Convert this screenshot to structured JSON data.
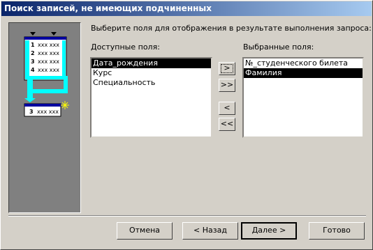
{
  "window": {
    "title": "Поиск записей, не имеющих подчиненных"
  },
  "instruction": "Выберите поля для отображения в результате выполнения запроса:",
  "available": {
    "label": "Доступные поля:",
    "items": [
      {
        "text": "Дата_рождения",
        "selected": true
      },
      {
        "text": "Курс",
        "selected": false
      },
      {
        "text": "Специальность",
        "selected": false
      }
    ]
  },
  "selected_fields": {
    "label": "Выбранные поля:",
    "items": [
      {
        "text": "№_студенческого билета",
        "selected": false
      },
      {
        "text": "Фамилия",
        "selected": true
      }
    ]
  },
  "move_buttons": {
    "add_one": ">",
    "add_all": ">>",
    "remove_one": "<",
    "remove_all": "<<"
  },
  "illustration": {
    "top_rows": [
      "1",
      "2",
      "3",
      "4"
    ],
    "row_text": "xxx xxx",
    "bottom_row": "3"
  },
  "footer": {
    "cancel": "Отмена",
    "back": "< Назад",
    "next": "Далее >",
    "finish": "Готово"
  }
}
